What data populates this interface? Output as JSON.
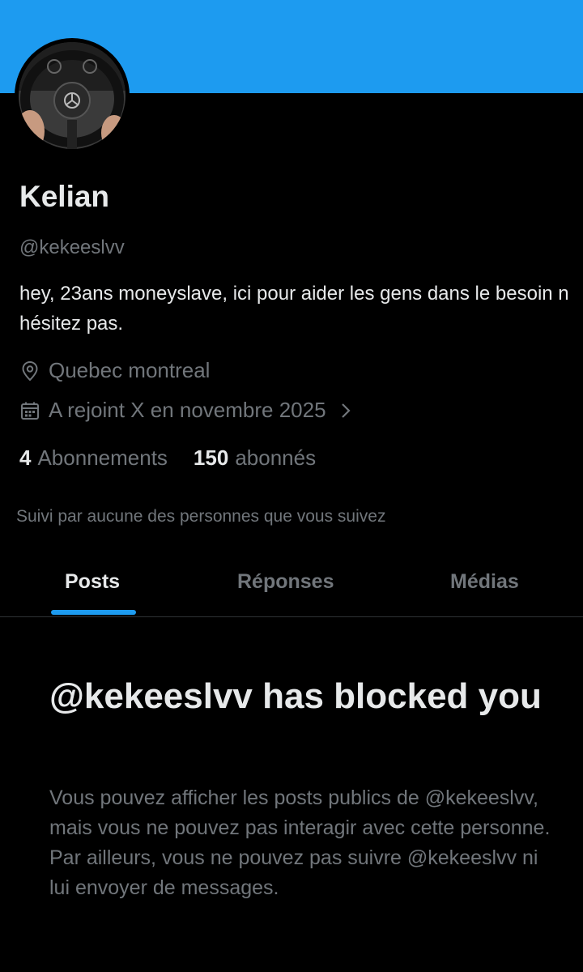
{
  "theme": {
    "accent": "#1d9bf0",
    "background": "#000000",
    "text": "#e7e9ea",
    "muted": "#71767b"
  },
  "profile": {
    "name": "Kelian",
    "handle": "@kekeeslvv",
    "bio": "hey, 23ans moneyslave, ici pour aider les gens dans le besoin n hésitez pas.",
    "location": "Quebec montreal",
    "joined": "A rejoint X en novembre 2025",
    "following_count": "4",
    "following_label": "Abonnements",
    "followers_count": "150",
    "followers_label": "abonnés",
    "followed_by": "Suivi par aucune des personnes que vous suivez"
  },
  "icons": {
    "location": "location-pin-icon",
    "calendar": "calendar-icon",
    "chevron": "chevron-right-icon"
  },
  "tabs": [
    {
      "label": "Posts",
      "active": true
    },
    {
      "label": "Réponses",
      "active": false
    },
    {
      "label": "Médias",
      "active": false
    }
  ],
  "blocked": {
    "title": "@kekeeslvv has blocked you",
    "description": "Vous pouvez afficher les posts publics de @kekeeslvv, mais vous ne pouvez pas interagir avec cette personne. Par ailleurs, vous ne pouvez pas suivre @kekeeslvv ni lui envoyer de messages."
  }
}
